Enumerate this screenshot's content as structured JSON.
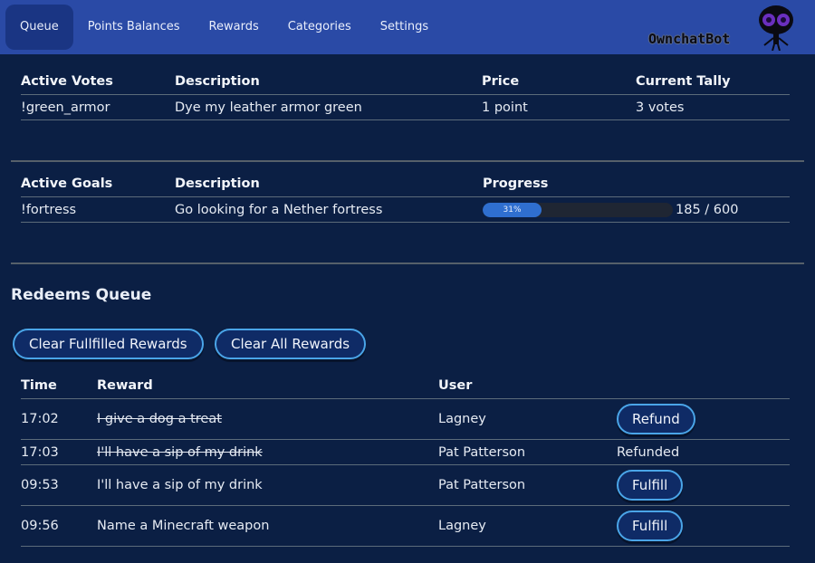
{
  "nav": {
    "items": [
      "Queue",
      "Points Balances",
      "Rewards",
      "Categories",
      "Settings"
    ],
    "active": "Queue"
  },
  "logo": {
    "text": "OwnchatBot"
  },
  "votes": {
    "headers": [
      "Active Votes",
      "Description",
      "Price",
      "Current Tally"
    ],
    "rows": [
      {
        "name": "!green_armor",
        "description": "Dye my leather armor green",
        "price": "1 point",
        "tally": "3 votes"
      }
    ]
  },
  "goals": {
    "headers": [
      "Active Goals",
      "Description",
      "Progress"
    ],
    "rows": [
      {
        "name": "!fortress",
        "description": "Go looking for a Nether fortress",
        "progress_label": "31%",
        "progress_fraction": 0.31,
        "count": "185 / 600"
      }
    ]
  },
  "redeems": {
    "title": "Redeems Queue",
    "clear_fulfilled_label": "Clear Fullfilled Rewards",
    "clear_all_label": "Clear All Rewards",
    "headers": [
      "Time",
      "Reward",
      "User",
      ""
    ],
    "rows": [
      {
        "time": "17:02",
        "reward": "I give a dog a treat",
        "user": "Lagney",
        "action": "Refund",
        "struck": true,
        "is_button": true
      },
      {
        "time": "17:03",
        "reward": "I'll have a sip of my drink",
        "user": "Pat Patterson",
        "action": "Refunded",
        "struck": true,
        "is_button": false
      },
      {
        "time": "09:53",
        "reward": "I'll have a sip of my drink",
        "user": "Pat Patterson",
        "action": "Fulfill",
        "struck": false,
        "is_button": true
      },
      {
        "time": "09:56",
        "reward": "Name a Minecraft weapon",
        "user": "Lagney",
        "action": "Fulfill",
        "struck": false,
        "is_button": true
      }
    ]
  },
  "colors": {
    "background": "#0b1f44",
    "topbar": "#2a4aa6",
    "active_tab": "#1a3583",
    "button_border": "#4aa5e8",
    "progress_fill": "#2f6fd0"
  }
}
